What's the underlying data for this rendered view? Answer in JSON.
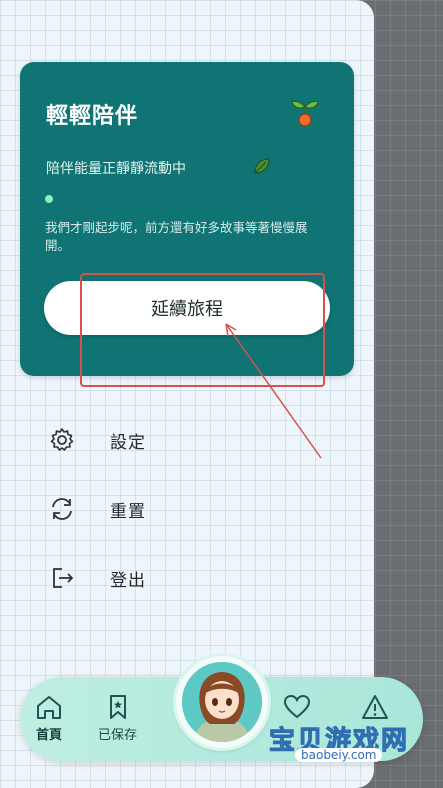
{
  "card": {
    "title": "輕輕陪伴",
    "subtitle": "陪伴能量正靜靜流動中",
    "description": "我們才剛起步呢，前方還有好多故事等著慢慢展開。",
    "continue_label": "延續旅程",
    "color": "#0f7473"
  },
  "menu": [
    {
      "label": "設定",
      "icon": "gear-icon"
    },
    {
      "label": "重置",
      "icon": "refresh-icon"
    },
    {
      "label": "登出",
      "icon": "logout-icon"
    }
  ],
  "bottom_nav": {
    "home_label": "首頁",
    "saved_label": "已保存",
    "items_right_icons": [
      "heart-icon",
      "warning-icon"
    ]
  },
  "watermark": {
    "text": "宝贝游戏网",
    "url": "baobeiy.com"
  },
  "annotation_color": "#d6514a"
}
